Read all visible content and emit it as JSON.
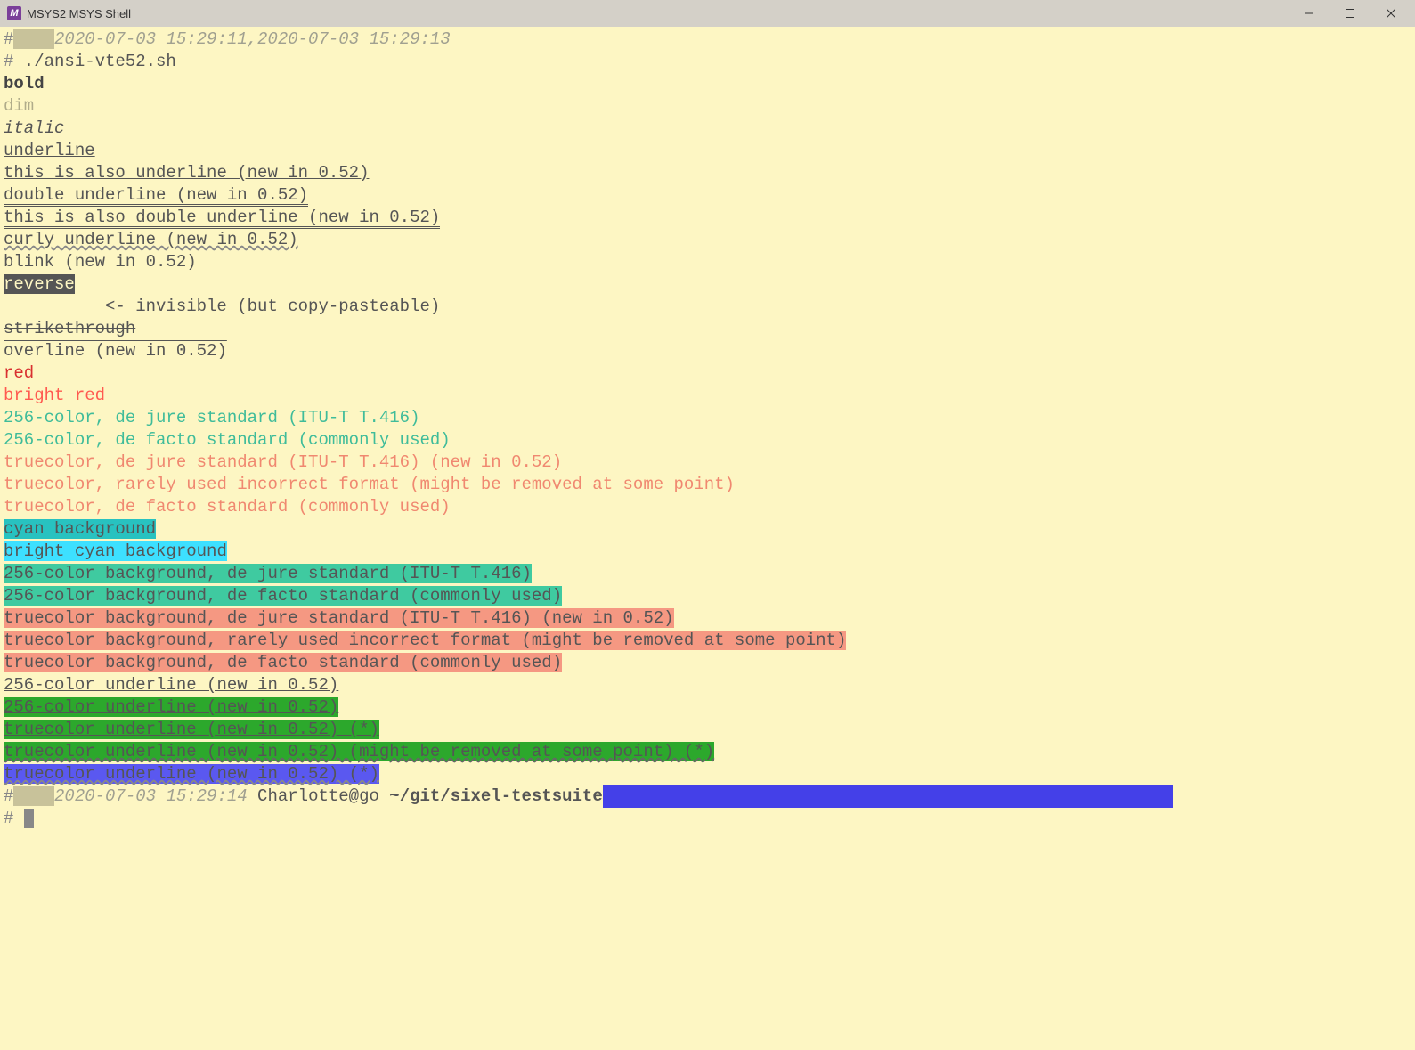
{
  "window": {
    "title": "MSYS2 MSYS Shell",
    "icon_letter": "M"
  },
  "prompt1": {
    "hash": "#",
    "timestamp": "2020-07-03 15:29:11,2020-07-03 15:29:13",
    "cmd_hash": "#",
    "command": " ./ansi-vte52.sh"
  },
  "lines": {
    "bold": "bold",
    "dim": "dim",
    "italic": "italic",
    "underline": "underline",
    "also_underline": "this is also underline (new in 0.52)",
    "double_underline": "double underline (new in 0.52)",
    "also_double_underline": "this is also double underline (new in 0.52)",
    "curly_underline": "curly underline (new in 0.52)",
    "blink": "blink (new in 0.52)",
    "reverse": "reverse",
    "invisible": " <- invisible (but copy-pasteable)",
    "strikethrough": "strikethrough",
    "overline": "overline (new in 0.52)",
    "red": "red",
    "bright_red": "bright red",
    "c256_jure": "256-color, de jure standard (ITU-T T.416)",
    "c256_facto": "256-color, de facto standard (commonly used)",
    "tc_jure": "truecolor, de jure standard (ITU-T T.416) (new in 0.52)",
    "tc_rare": "truecolor, rarely used incorrect format (might be removed at some point)",
    "tc_facto": "truecolor, de facto standard (commonly used)",
    "cyan_bg": "cyan background",
    "bright_cyan_bg": "bright cyan background",
    "c256_bg_jure": "256-color background, de jure standard (ITU-T T.416)",
    "c256_bg_facto": "256-color background, de facto standard (commonly used)",
    "tc_bg_jure": "truecolor background, de jure standard (ITU-T T.416) (new in 0.52)",
    "tc_bg_rare": "truecolor background, rarely used incorrect format (might be removed at some point)",
    "tc_bg_facto": "truecolor background, de facto standard (commonly used)",
    "c256_ul": "256-color underline (new in 0.52)",
    "c256_ul2": "256-color underline (new in 0.52)",
    "tc_ul_star": "truecolor underline (new in 0.52) (*)",
    "tc_ul_removed": "truecolor underline (new in 0.52) (might be removed at some point) (*)",
    "tc_ul_star2": "truecolor underline (new in 0.52) (*)"
  },
  "prompt2": {
    "hash": "#",
    "timestamp": "2020-07-03 15:29:14",
    "user_host": " Charlotte@go ",
    "path": "~/git/sixel-testsuite",
    "hash2": "#"
  }
}
